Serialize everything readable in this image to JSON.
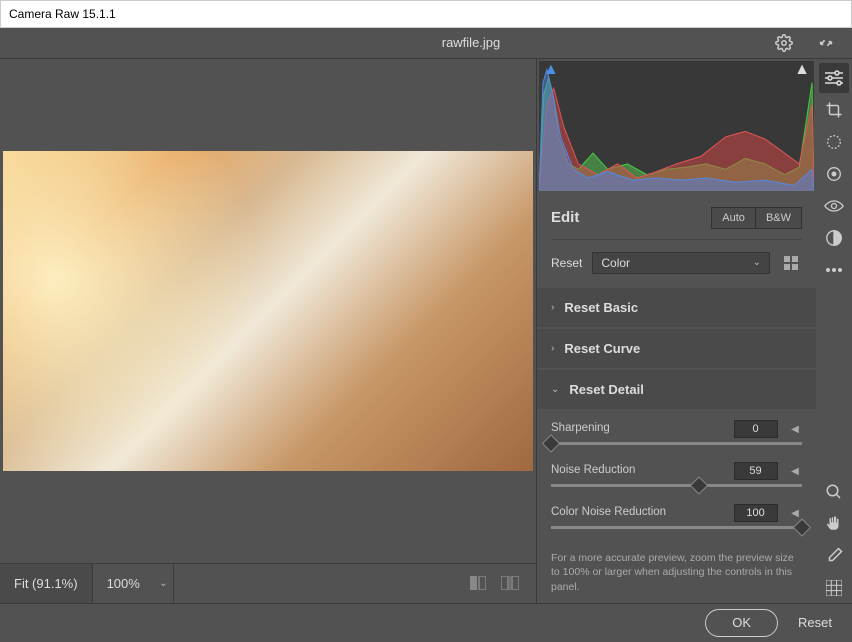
{
  "window": {
    "title": "Camera Raw 15.1.1"
  },
  "header": {
    "filename": "rawfile.jpg"
  },
  "bottom": {
    "fit_label": "Fit (91.1%)",
    "zoom": "100%"
  },
  "edit": {
    "title": "Edit",
    "auto_label": "Auto",
    "bw_label": "B&W",
    "reset_label": "Reset",
    "preset_dropdown": "Color",
    "sections": {
      "basic": "Reset Basic",
      "curve": "Reset Curve",
      "detail": "Reset Detail"
    },
    "sliders": {
      "sharpening": {
        "label": "Sharpening",
        "value": "0",
        "pct": 0
      },
      "noise": {
        "label": "Noise Reduction",
        "value": "59",
        "pct": 59
      },
      "color_noise": {
        "label": "Color Noise Reduction",
        "value": "100",
        "pct": 100
      }
    },
    "hint": "For a more accurate preview, zoom the preview size to 100% or larger when adjusting the controls in this panel."
  },
  "footer": {
    "ok": "OK",
    "reset": "Reset"
  }
}
